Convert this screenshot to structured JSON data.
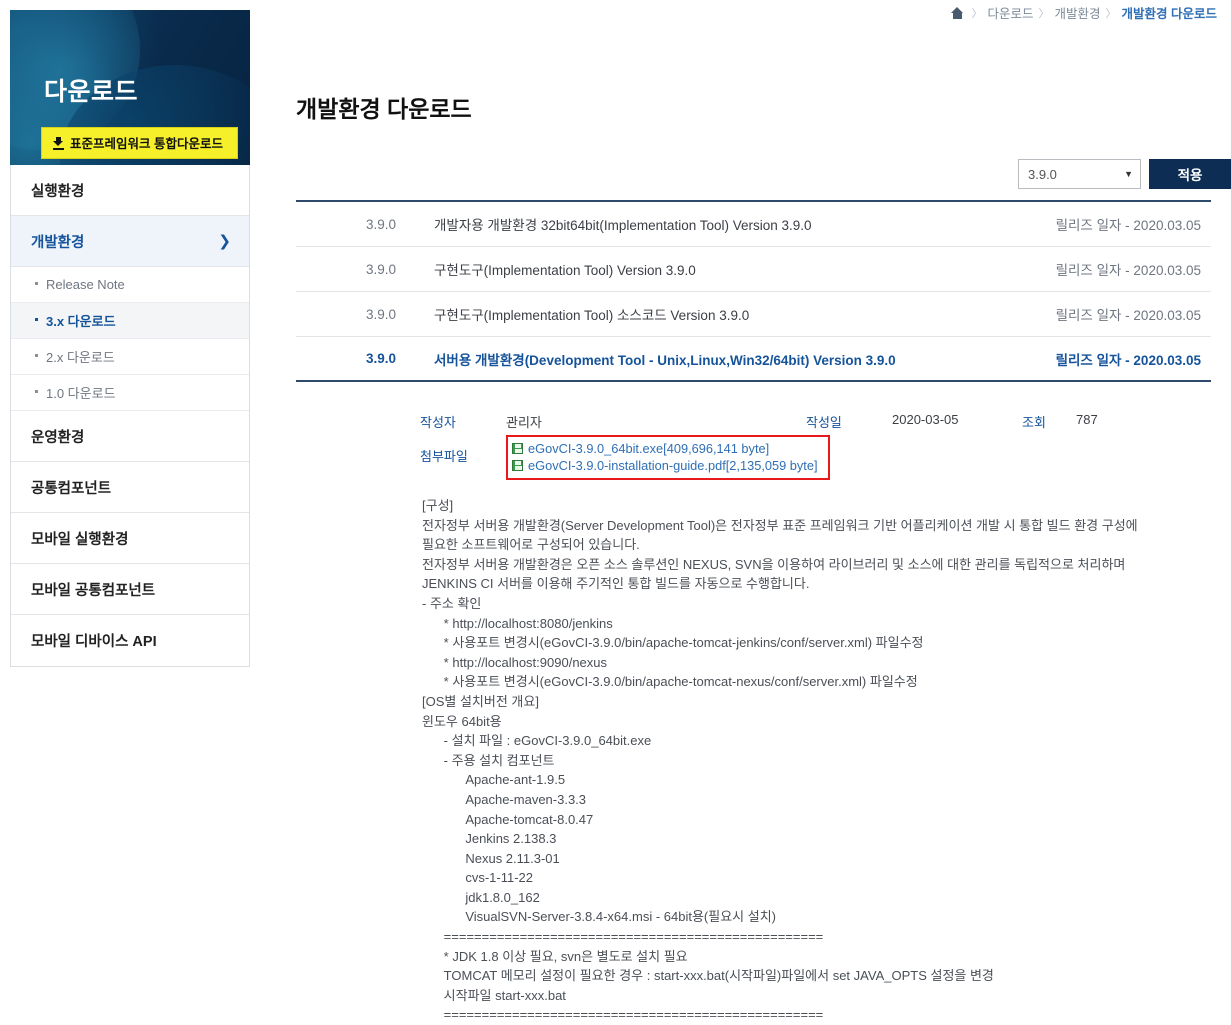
{
  "breadcrumb": {
    "home_icon": "home-icon",
    "items": [
      {
        "label": "다운로드",
        "current": false
      },
      {
        "label": "개발환경",
        "current": false
      },
      {
        "label": "개발환경 다운로드",
        "current": true
      }
    ],
    "separator": "〉"
  },
  "sidebar": {
    "title": "다운로드",
    "download_button": {
      "label": "표준프레임워크 통합다운로드",
      "icon": "download-icon"
    },
    "items": [
      {
        "label": "실행환경",
        "active": false,
        "chevron": ""
      },
      {
        "label": "개발환경",
        "active": true,
        "chevron": "❯"
      },
      {
        "label": "운영환경",
        "active": false,
        "chevron": ""
      },
      {
        "label": "공통컴포넌트",
        "active": false,
        "chevron": ""
      },
      {
        "label": "모바일 실행환경",
        "active": false,
        "chevron": ""
      },
      {
        "label": "모바일 공통컴포넌트",
        "active": false,
        "chevron": ""
      },
      {
        "label": "모바일 디바이스 API",
        "active": false,
        "chevron": ""
      }
    ],
    "sub_items": [
      {
        "label": "Release Note",
        "active": false
      },
      {
        "label": "3.x 다운로드",
        "active": true
      },
      {
        "label": "2.x 다운로드",
        "active": false
      },
      {
        "label": "1.0 다운로드",
        "active": false
      }
    ]
  },
  "main": {
    "page_title": "개발환경 다운로드",
    "filter": {
      "selected_version": "3.9.0",
      "caret_icon": "chevron-down-icon",
      "apply_label": "적용"
    },
    "table": {
      "rows": [
        {
          "version": "3.9.0",
          "name": "개발자용 개발환경 32bit64bit(Implementation Tool) Version 3.9.0",
          "date": "릴리즈 일자 - 2020.03.05",
          "selected": false
        },
        {
          "version": "3.9.0",
          "name": "구현도구(Implementation Tool) Version 3.9.0",
          "date": "릴리즈 일자 - 2020.03.05",
          "selected": false
        },
        {
          "version": "3.9.0",
          "name": "구현도구(Implementation Tool) 소스코드 Version 3.9.0",
          "date": "릴리즈 일자 - 2020.03.05",
          "selected": false
        },
        {
          "version": "3.9.0",
          "name": "서버용 개발환경(Development Tool - Unix,Linux,Win32/64bit) Version 3.9.0",
          "date": "릴리즈 일자 - 2020.03.05",
          "selected": true
        }
      ]
    },
    "detail": {
      "writer_label": "작성자",
      "writer_value": "관리자",
      "date_label": "작성일",
      "date_value": "2020-03-05",
      "views_label": "조회",
      "views_value": "787",
      "attach_label": "첨부파일",
      "attach_highlight_color": "#e8191b",
      "files": [
        {
          "icon": "floppy-disk-icon",
          "name": "eGovCI-3.9.0_64bit.exe[409,696,141 byte]"
        },
        {
          "icon": "floppy-disk-icon",
          "name": "eGovCI-3.9.0-installation-guide.pdf[2,135,059 byte]"
        }
      ],
      "description": "[구성]\n전자정부 서버용 개발환경(Server Development Tool)은 전자정부 표준 프레임워크 기반 어플리케이션 개발 시 통합 빌드 환경 구성에\n필요한 소프트웨어로 구성되어 있습니다.\n전자정부 서버용 개발환경은 오픈 소스 솔루션인 NEXUS, SVN을 이용하여 라이브러리 및 소스에 대한 관리를 독립적으로 처리하며\nJENKINS CI 서버를 이용해 주기적인 통합 빌드를 자동으로 수행합니다.\n- 주소 확인\n      * http://localhost:8080/jenkins\n      * 사용포트 변경시(eGovCI-3.9.0/bin/apache-tomcat-jenkins/conf/server.xml) 파일수정\n      * http://localhost:9090/nexus\n      * 사용포트 변경시(eGovCI-3.9.0/bin/apache-tomcat-nexus/conf/server.xml) 파일수정\n[OS별 설치버전 개요]\n윈도우 64bit용\n      - 설치 파일 : eGovCI-3.9.0_64bit.exe\n      - 주용 설치 컴포넌트\n            Apache-ant-1.9.5\n            Apache-maven-3.3.3\n            Apache-tomcat-8.0.47\n            Jenkins 2.138.3\n            Nexus 2.11.3-01\n            cvs-1-11-22\n            jdk1.8.0_162\n            VisualSVN-Server-3.8.4-x64.msi - 64bit용(필요시 설치)\n      ==================================================\n      * JDK 1.8 이상 필요, svn은 별도로 설치 필요\n      TOMCAT 메모리 설정이 필요한 경우 : start-xxx.bat(시작파일)파일에서 set JAVA_OPTS 설정을 변경\n      시작파일 start-xxx.bat\n      =================================================="
    }
  },
  "colors": {
    "brand_navy": "#0d2d55",
    "accent_blue": "#15539b",
    "highlight_yellow": "#f5f02a",
    "alert_red": "#e8191b",
    "file_green": "#3f9a4e"
  }
}
